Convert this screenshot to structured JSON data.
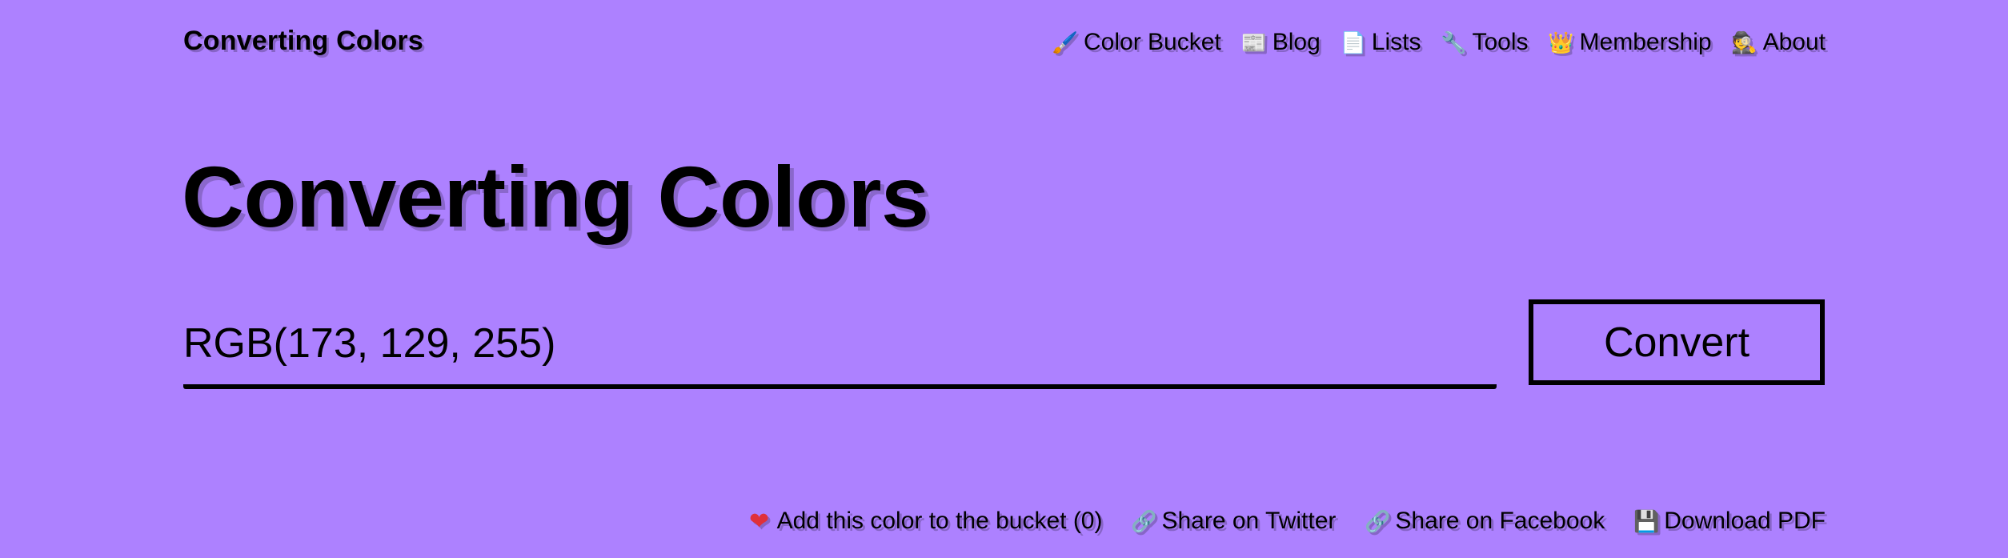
{
  "header": {
    "brand": "Converting Colors"
  },
  "nav": {
    "items": [
      {
        "label": "Color Bucket",
        "icon": "paintbrush-icon"
      },
      {
        "label": "Blog",
        "icon": "newspaper-icon"
      },
      {
        "label": "Lists",
        "icon": "page-icon"
      },
      {
        "label": "Tools",
        "icon": "wrench-icon"
      },
      {
        "label": "Membership",
        "icon": "crown-icon"
      },
      {
        "label": "About",
        "icon": "detective-icon"
      }
    ]
  },
  "main": {
    "title": "Converting Colors",
    "input_value": "RGB(173, 129, 255)",
    "convert_label": "Convert"
  },
  "actions": {
    "items": [
      {
        "label": "Add this color to the bucket (0)",
        "icon": "heart-icon"
      },
      {
        "label": "Share on Twitter",
        "icon": "link-icon"
      },
      {
        "label": "Share on Facebook",
        "icon": "link-icon"
      },
      {
        "label": "Download PDF",
        "icon": "floppy-disk-icon"
      }
    ]
  },
  "colors": {
    "background": "#ad81ff",
    "text": "#000000"
  }
}
